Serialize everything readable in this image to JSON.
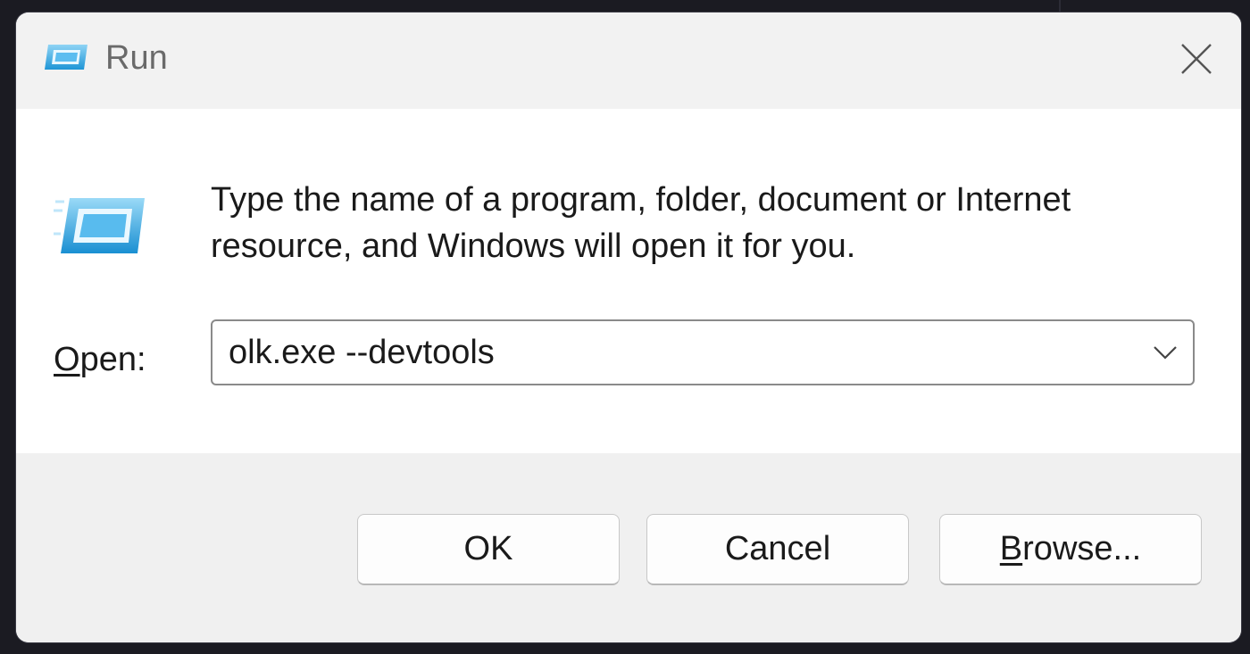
{
  "window": {
    "title": "Run",
    "title_icon": "run-icon",
    "close_icon": "close-icon"
  },
  "content": {
    "icon": "run-icon",
    "description": "Type the name of a program, folder, document or Internet resource, and Windows will open it for you.",
    "open_label_accel": "O",
    "open_label_rest": "pen:",
    "open_value": "olk.exe --devtools",
    "dropdown_icon": "chevron-down-icon"
  },
  "buttons": {
    "ok": "OK",
    "cancel": "Cancel",
    "browse_accel": "B",
    "browse_rest": "rowse..."
  },
  "colors": {
    "icon_accent": "#2aa3e0",
    "icon_light": "#8fd4f5"
  }
}
